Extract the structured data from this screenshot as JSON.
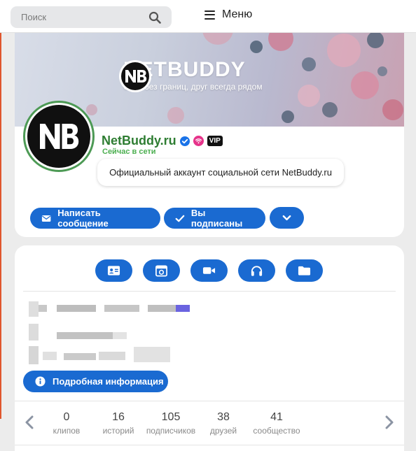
{
  "search": {
    "placeholder": "Поиск"
  },
  "menu": {
    "label": "Меню"
  },
  "banner": {
    "brand_title": "NETBUDDY",
    "tagline": "Сеть без границ, друг всегда рядом"
  },
  "profile": {
    "name": "NetBuddy.ru",
    "status": "Сейчас в сети",
    "vip_label": "VIP",
    "bio": "Официальный аккаунт социальной сети NetBuddy.ru",
    "accent_color": "#1a6ad1",
    "name_color": "#2e7d32"
  },
  "actions": {
    "message_label": "Написать сообщение",
    "subscribed_label": "Вы подписаны",
    "more_icon": "chevron-down-icon"
  },
  "tabs": [
    {
      "icon": "id-card-icon"
    },
    {
      "icon": "calendar-icon"
    },
    {
      "icon": "video-camera-icon"
    },
    {
      "icon": "headphones-icon"
    },
    {
      "icon": "folder-icon"
    }
  ],
  "details_label": "Подробная информация",
  "stats": [
    {
      "value": "0",
      "label": "клипов"
    },
    {
      "value": "16",
      "label": "историй"
    },
    {
      "value": "105",
      "label": "подписчиков"
    },
    {
      "value": "38",
      "label": "друзей"
    },
    {
      "value": "41",
      "label": "сообщество"
    }
  ]
}
